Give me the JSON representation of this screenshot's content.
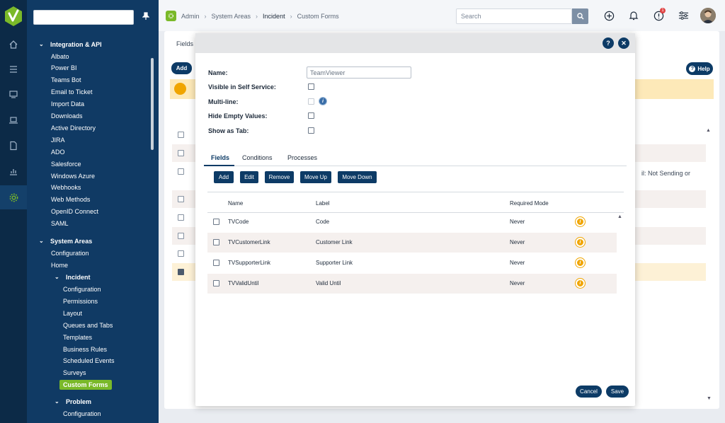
{
  "sidebar": {
    "search_placeholder": "",
    "sections": [
      {
        "label": "Integration & API",
        "items": [
          "Albato",
          "Power BI",
          "Teams Bot",
          "Email to Ticket",
          "Import Data",
          "Downloads",
          "Active Directory",
          "JIRA",
          "ADO",
          "Salesforce",
          "Windows Azure",
          "Webhooks",
          "Web Methods",
          "OpenID Connect",
          "SAML"
        ]
      },
      {
        "label": "System Areas",
        "items": [
          "Configuration",
          "Home"
        ]
      }
    ],
    "incident": {
      "label": "Incident",
      "items": [
        "Configuration",
        "Permissions",
        "Layout",
        "Queues and Tabs",
        "Templates",
        "Business Rules",
        "Scheduled Events",
        "Surveys",
        "Custom Forms"
      ]
    },
    "problem": {
      "label": "Problem",
      "items": [
        "Configuration"
      ]
    },
    "active_item": "Custom Forms"
  },
  "header": {
    "breadcrumbs": [
      "Admin",
      "System Areas",
      "Incident",
      "Custom Forms"
    ],
    "search_placeholder": "Search",
    "notification_count": "1"
  },
  "background": {
    "fields_label": "Fields",
    "add_label": "Add",
    "help_label": "Help",
    "peek_text": "il: Not Sending or"
  },
  "modal": {
    "form": {
      "name_label": "Name:",
      "name_value": "TeamViewer",
      "visible_label": "Visible in Self Service:",
      "multiline_label": "Multi-line:",
      "hide_empty_label": "Hide Empty Values:",
      "show_tab_label": "Show as Tab:"
    },
    "tabs": [
      "Fields",
      "Conditions",
      "Processes"
    ],
    "actions": [
      "Add",
      "Edit",
      "Remove",
      "Move Up",
      "Move Down"
    ],
    "columns": [
      "Name",
      "Label",
      "Required Mode"
    ],
    "rows": [
      {
        "name": "TVCode",
        "label": "Code",
        "required": "Never"
      },
      {
        "name": "TVCustomerLink",
        "label": "Customer Link",
        "required": "Never"
      },
      {
        "name": "TVSupporterLink",
        "label": "Supporter Link",
        "required": "Never"
      },
      {
        "name": "TVValidUntil",
        "label": "Valid Until",
        "required": "Never"
      }
    ],
    "cancel_label": "Cancel",
    "save_label": "Save"
  },
  "colors": {
    "navy": "#0d3b66",
    "sidebar": "#103a64",
    "accent_green": "#7ab929",
    "warning": "#f0a500"
  }
}
